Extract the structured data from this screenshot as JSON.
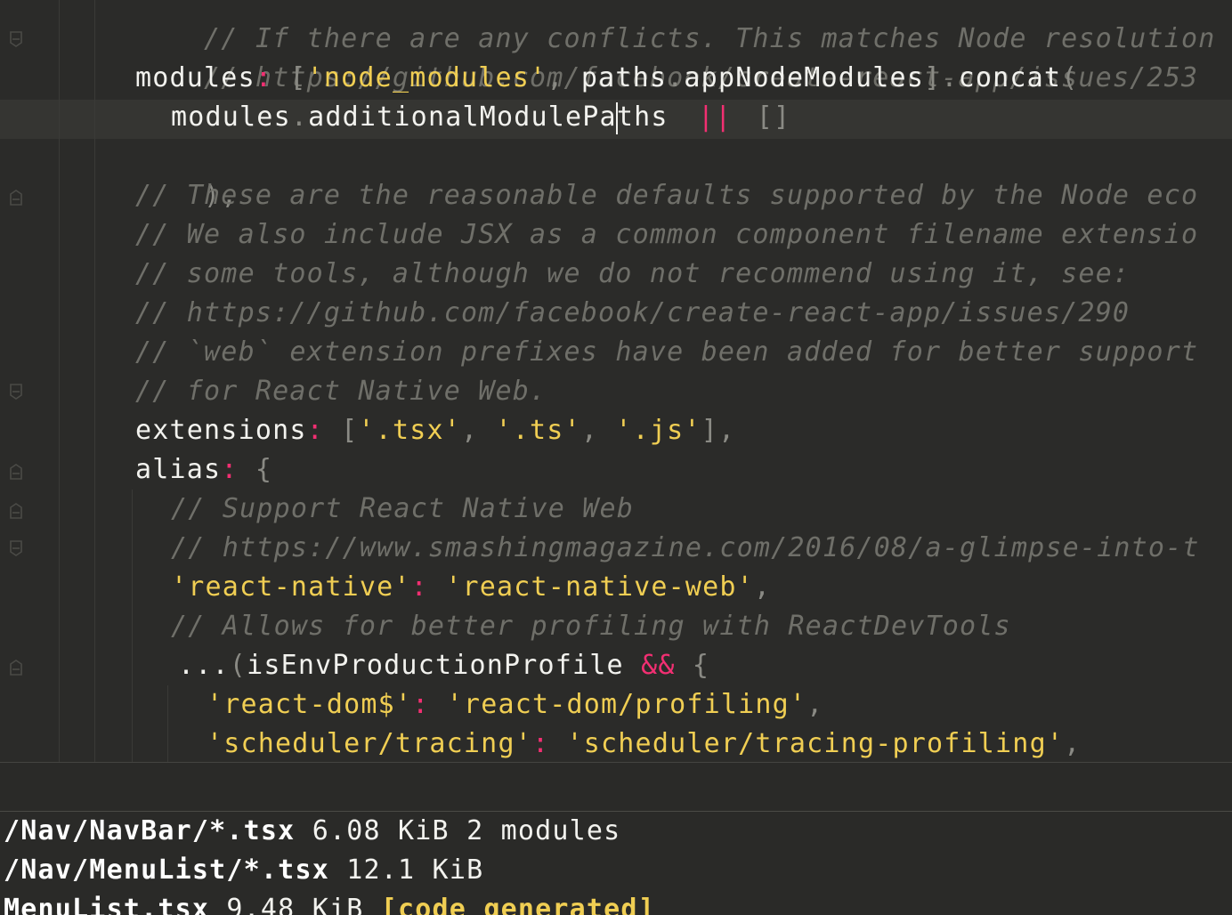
{
  "editor": {
    "lines": [
      {
        "comment": "// If there are any conflicts. This matches Node resolution me"
      },
      {
        "comment": "// https://github.com/facebook/create-react-app/issues/253"
      },
      {
        "key": "modules",
        "colon": ":",
        "open": " [",
        "str1": "'node_modules'",
        "comma": ",",
        "ident": " paths",
        "dot": ".",
        "ident2": "appNodeModules",
        "close": "]",
        "dot2": ".",
        "ident3": "concat",
        "paren": "("
      },
      {
        "ident_a": "modules",
        "dot": ".",
        "ident_b1": "additionalModulePa",
        "ident_b2": "ths",
        "op": "||",
        "arr": "[]"
      },
      {
        "text": "),"
      },
      {
        "comment": "// These are the reasonable defaults supported by the Node eco"
      },
      {
        "comment": "// We also include JSX as a common component filename extensio"
      },
      {
        "comment": "// some tools, although we do not recommend using it, see:"
      },
      {
        "comment": "// https://github.com/facebook/create-react-app/issues/290"
      },
      {
        "comment": "// `web` extension prefixes have been added for better support"
      },
      {
        "comment": "// for React Native Web."
      },
      {
        "key": "extensions",
        "colon": ":",
        "open": " [",
        "s1": "'.tsx'",
        "c1": ",",
        "s2": " '.ts'",
        "c2": ",",
        "s3": " '.js'",
        "close": "],"
      },
      {
        "key": "alias",
        "colon": ":",
        "brace": " {"
      },
      {
        "comment": "// Support React Native Web"
      },
      {
        "comment": "// https://www.smashingmagazine.com/2016/08/a-glimpse-into-t"
      },
      {
        "s1": "'react-native'",
        "colon": ":",
        "s2": " 'react-native-web'",
        "comma": ","
      },
      {
        "comment": "// Allows for better profiling with ReactDevTools"
      },
      {
        "spread": "...",
        "paren": "(",
        "ident": "isEnvProductionProfile",
        "op": "&&",
        "brace": " {"
      },
      {
        "s1": "'react-dom$'",
        "colon": ":",
        "s2": " 'react-dom/profiling'",
        "comma": ","
      },
      {
        "s1": "'scheduler/tracing'",
        "colon": ":",
        "s2": " 'scheduler/tracing-profiling'",
        "comma": ","
      }
    ]
  },
  "terminal": {
    "lines": [
      {
        "path": "/Nav/NavBar/*.tsx",
        "info": " 6.08 KiB 2 modules"
      },
      {
        "path": "/Nav/MenuList/*.tsx",
        "info": " 12.1 KiB"
      },
      {
        "path": "MenuList.tsx",
        "info": " 9.48 KiB ",
        "tag": "[code generated]"
      }
    ]
  },
  "colors": {
    "background": "#2b2b29",
    "comment": "#6f6f69",
    "string": "#f0ce53",
    "operator": "#f22f72",
    "text": "#f2f2ee"
  },
  "icons": [
    "fold-open-icon",
    "fold-close-icon"
  ]
}
